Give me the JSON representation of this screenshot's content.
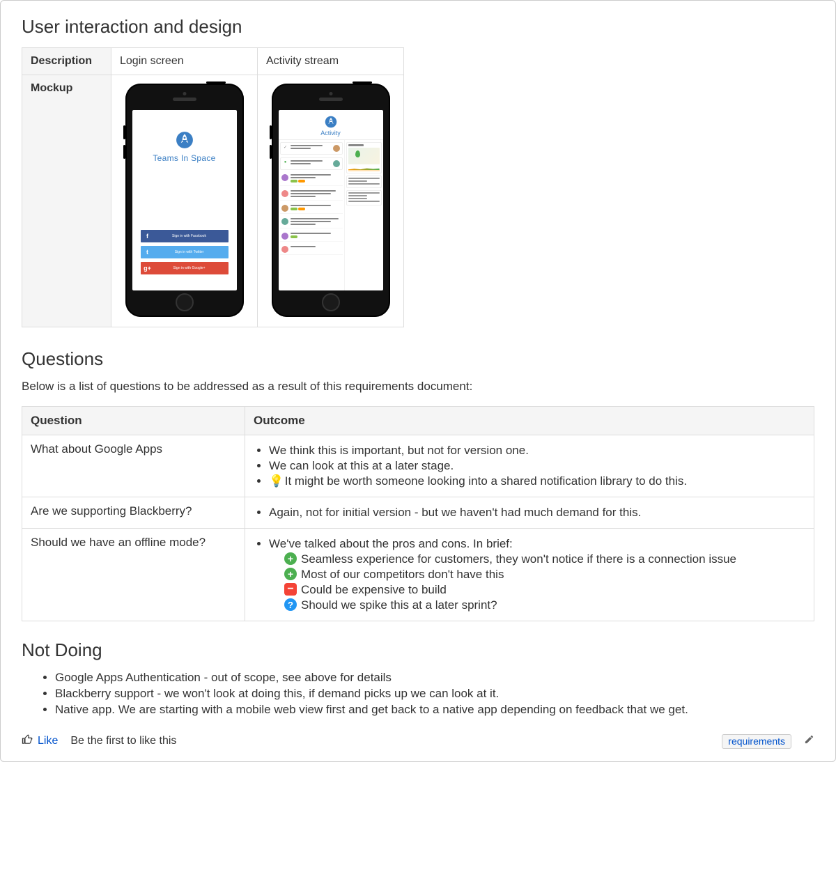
{
  "sections": {
    "ui_design_heading": "User interaction and design",
    "questions_heading": "Questions",
    "questions_intro": "Below is a list of questions to be addressed as a result of this requirements document:",
    "not_doing_heading": "Not Doing"
  },
  "mockup_table": {
    "row_headers": {
      "description": "Description",
      "mockup": "Mockup"
    },
    "columns": {
      "login": "Login screen",
      "activity": "Activity stream"
    },
    "login_mock": {
      "brand": "Teams In Space",
      "buttons": {
        "facebook": "Sign in with Facebook",
        "twitter": "Sign in with Twitter",
        "google": "Sign in with Google+"
      }
    },
    "activity_mock": {
      "title": "Activity"
    }
  },
  "questions_table": {
    "headers": {
      "question": "Question",
      "outcome": "Outcome"
    },
    "rows": [
      {
        "question": "What about Google Apps",
        "outcomes": [
          "We think this is important, but not for version one.",
          "We can look at this at a later stage.",
          "It might be worth someone looking into a shared notification library to do this."
        ],
        "last_has_bulb": true
      },
      {
        "question": "Are we supporting Blackberry?",
        "outcomes": [
          "Again, not for initial version - but we haven't had much demand for this."
        ]
      },
      {
        "question": "Should we have an offline mode?",
        "intro": "We've talked about the pros and cons. In brief:",
        "points": [
          {
            "icon": "plus",
            "text": "Seamless experience for customers, they won't notice if there is a connection issue"
          },
          {
            "icon": "plus",
            "text": "Most of our competitors don't have this"
          },
          {
            "icon": "minus",
            "text": "Could be expensive to build"
          },
          {
            "icon": "q",
            "text": "Should we spike this at a later sprint?"
          }
        ]
      }
    ]
  },
  "not_doing": [
    "Google Apps Authentication - out of scope, see above for details",
    "Blackberry support - we won't look at doing this, if demand picks up we can look at it.",
    "Native app. We are starting with a mobile web view first and get back to a native app depending on feedback that we get."
  ],
  "footer": {
    "like": "Like",
    "be_first": "Be the first to like this",
    "tag": "requirements"
  }
}
